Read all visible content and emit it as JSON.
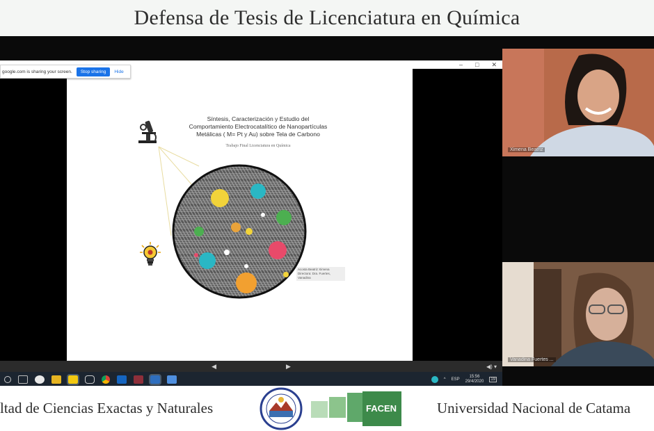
{
  "header": {
    "title": "Defensa de Tesis de Licenciatura en Química"
  },
  "sharing_bar": {
    "message": "google.com is sharing your screen.",
    "stop_label": "Stop sharing",
    "hide_label": "Hide"
  },
  "window_controls": {
    "minimize": "–",
    "maximize": "□",
    "close": "✕"
  },
  "slide": {
    "title_line1": "Síntesis, Caracterización y Estudio del",
    "title_line2": "Comportamiento Electrocatalítico de Nanopartículas",
    "title_line3": "Metálicas ( M= Pt y Au) sobre Tela de Carbono",
    "subtitle": "Trabajo Final Licenciatura en Química",
    "authors_line1": "Acosta Beatriz Ximena",
    "authors_line2": "Directora: Dra. Fuertes, Vanadina"
  },
  "slide_nav": {
    "prev": "◀",
    "next": "▶",
    "volume": "◀) ▾"
  },
  "taskbar": {
    "icons": [
      "search-icon",
      "task-view-icon",
      "chat-icon",
      "file-explorer-icon",
      "sticky-notes-icon",
      "camera-icon",
      "chrome-icon",
      "outlook-icon",
      "gallery-icon",
      "app-icon",
      "app-icon-2"
    ],
    "language": "ESP",
    "time": "15:56",
    "date": "29/4/2020",
    "notifications": "19"
  },
  "participants": [
    {
      "name": "Ximena Beatriz"
    },
    {
      "name": "Vanadina Fuertes ..."
    }
  ],
  "footer": {
    "left_text": "ltad de Ciencias Exactas y Naturales",
    "right_text": "Universidad Nacional de Catama",
    "facen_label": "FACEN"
  },
  "colors": {
    "background_dark": "#0a0a0a",
    "stop_button": "#1a73e8",
    "facen_green": "#3d8a4a",
    "tile1_bg": "#b05a3c",
    "tile2_bg": "#6a4d3a"
  }
}
